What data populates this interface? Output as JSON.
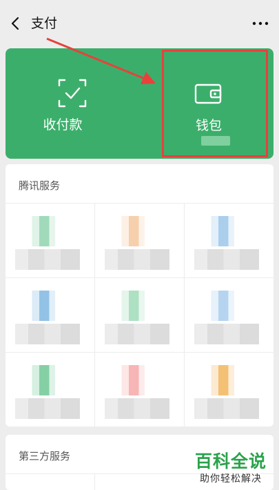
{
  "header": {
    "title": "支付",
    "back_icon": "chevron-left-icon",
    "more_icon": "more-dots-icon"
  },
  "payment_card": {
    "accent": "#3cae6b",
    "highlight_color": "#e8413c",
    "pay_label": "收付款",
    "wallet_label": "钱包"
  },
  "sections": {
    "tencent_title": "腾讯服务",
    "third_party_title": "第三方服务"
  },
  "tencent_services": [
    {
      "icon": "blurred-service-icon",
      "tint": "#8fd4ae"
    },
    {
      "icon": "blurred-service-icon",
      "tint": "#f5c79e"
    },
    {
      "icon": "blurred-service-icon",
      "tint": "#9cc6ea"
    },
    {
      "icon": "blurred-service-icon",
      "tint": "#7fb8e2"
    },
    {
      "icon": "blurred-service-icon",
      "tint": "#9fdcb8"
    },
    {
      "icon": "blurred-service-icon",
      "tint": "#a9cdee"
    },
    {
      "icon": "blurred-service-icon",
      "tint": "#6fc894"
    },
    {
      "icon": "blurred-service-icon",
      "tint": "#f7a8a8"
    },
    {
      "icon": "blurred-service-icon",
      "tint": "#f2b65c"
    }
  ],
  "watermark": {
    "main": "百科全说",
    "sub": "助你轻松解决"
  }
}
